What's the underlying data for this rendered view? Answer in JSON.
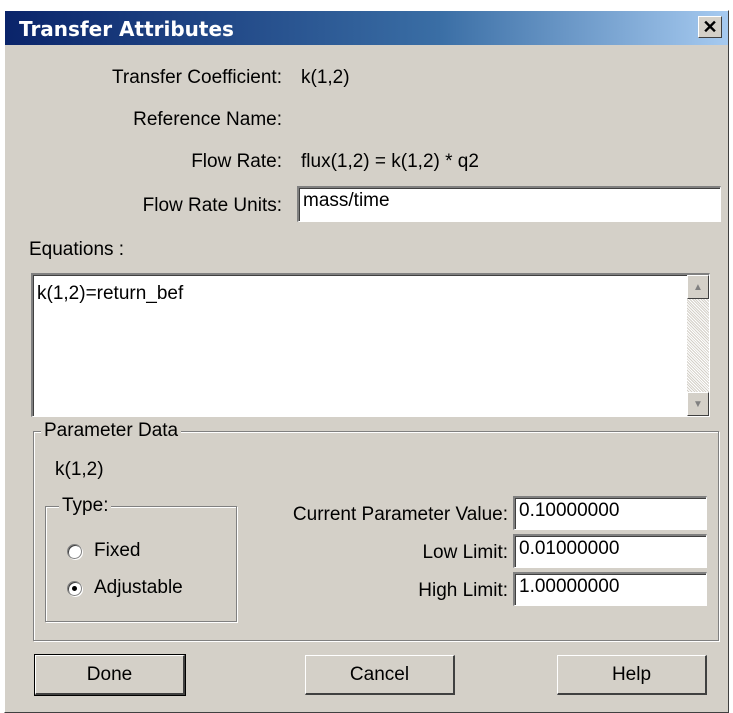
{
  "window": {
    "title": "Transfer Attributes",
    "close_glyph": "✕"
  },
  "info": {
    "transfer_coefficient_label": "Transfer Coefficient:",
    "transfer_coefficient_value": "k(1,2)",
    "reference_name_label": "Reference Name:",
    "reference_name_value": "",
    "flow_rate_label": "Flow Rate:",
    "flow_rate_value": "flux(1,2) = k(1,2) * q2",
    "flow_rate_units_label": "Flow Rate Units:",
    "flow_rate_units_value": "mass/time"
  },
  "equations": {
    "label": "Equations :",
    "text": "k(1,2)=return_bef"
  },
  "parameter_data": {
    "legend": "Parameter Data",
    "param_name": "k(1,2)",
    "type": {
      "legend": "Type:",
      "options": [
        {
          "label": "Fixed",
          "selected": false
        },
        {
          "label": "Adjustable",
          "selected": true
        }
      ]
    },
    "current_value_label": "Current Parameter Value:",
    "current_value": "0.10000000",
    "low_limit_label": "Low Limit:",
    "low_limit": "0.01000000",
    "high_limit_label": "High Limit:",
    "high_limit": "1.00000000"
  },
  "buttons": {
    "done": "Done",
    "cancel": "Cancel",
    "help": "Help"
  },
  "icons": {
    "close": "close-icon",
    "scroll_up": "scroll-up-arrow-icon",
    "scroll_down": "scroll-down-arrow-icon"
  },
  "colors": {
    "face": "#d4d0c8",
    "title_start": "#0a246a",
    "title_end": "#a6caf0",
    "field": "#ffffff"
  }
}
